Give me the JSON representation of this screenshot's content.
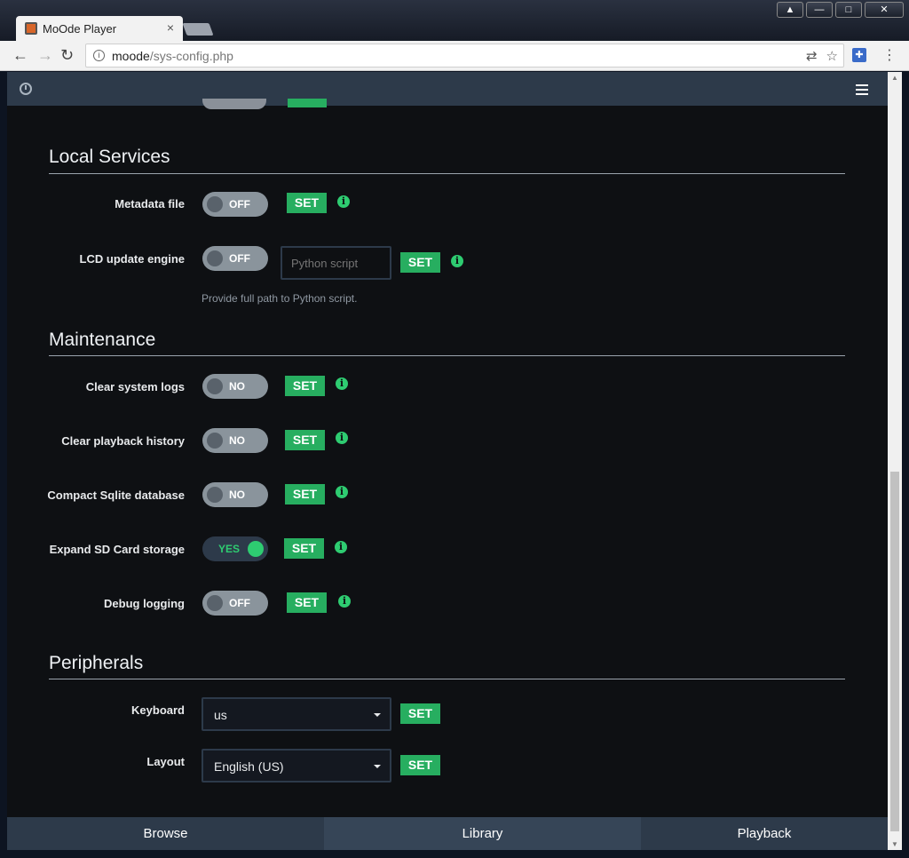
{
  "browser": {
    "tab_title": "MoOde Player",
    "tab_close": "×",
    "url_host": "moode",
    "url_path": "/sys-config.php",
    "win_min": "—",
    "win_max": "□",
    "win_close": "✕",
    "win_user": "▲"
  },
  "local_services": {
    "title": "Local Services",
    "metadata": {
      "label": "Metadata file",
      "state": "OFF",
      "set": "SET"
    },
    "lcd": {
      "label": "LCD update engine",
      "state": "OFF",
      "input_placeholder": "Python script",
      "set": "SET",
      "help": "Provide full path to Python script."
    }
  },
  "maintenance": {
    "title": "Maintenance",
    "clear_logs": {
      "label": "Clear system logs",
      "state": "NO",
      "set": "SET"
    },
    "clear_history": {
      "label": "Clear playback history",
      "state": "NO",
      "set": "SET"
    },
    "compact_db": {
      "label": "Compact Sqlite database",
      "state": "NO",
      "set": "SET"
    },
    "expand_sd": {
      "label": "Expand SD Card storage",
      "state": "YES",
      "set": "SET"
    },
    "debug": {
      "label": "Debug logging",
      "state": "OFF",
      "set": "SET"
    }
  },
  "peripherals": {
    "title": "Peripherals",
    "keyboard": {
      "label": "Keyboard",
      "value": "us",
      "set": "SET"
    },
    "layout": {
      "label": "Layout",
      "value": "English (US)",
      "set": "SET"
    }
  },
  "footer": {
    "tabs": [
      "Browse",
      "Library",
      "Playback"
    ]
  },
  "icons": {
    "info": "i"
  },
  "colors": {
    "accent": "#27ae60",
    "header": "#2d3a4a",
    "background": "#0e1013"
  }
}
